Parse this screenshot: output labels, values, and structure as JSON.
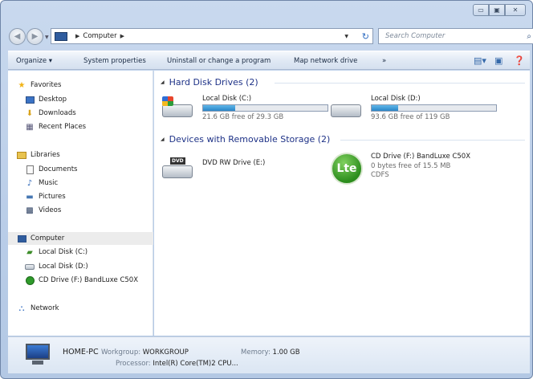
{
  "window": {
    "caption_buttons": [
      "minimize",
      "maximize",
      "close"
    ]
  },
  "address_bar": {
    "breadcrumb": "Computer",
    "search_placeholder": "Search Computer"
  },
  "command_bar": {
    "organize": "Organize",
    "system_properties": "System properties",
    "uninstall": "Uninstall or change a program",
    "map_drive": "Map network drive",
    "more": "»"
  },
  "nav_pane": {
    "favorites": "Favorites",
    "desktop": "Desktop",
    "downloads": "Downloads",
    "recent_places": "Recent Places",
    "libraries": "Libraries",
    "documents": "Documents",
    "music": "Music",
    "pictures": "Pictures",
    "videos": "Videos",
    "computer": "Computer",
    "local_c": "Local Disk (C:)",
    "local_d": "Local Disk (D:)",
    "cd_drive": "CD Drive (F:) BandLuxe C50X",
    "network": "Network"
  },
  "content": {
    "hdd_header": "Hard Disk Drives (2)",
    "drives": [
      {
        "name": "Local Disk (C:)",
        "free": "21.6 GB free of 29.3 GB",
        "used_fraction": 0.26
      },
      {
        "name": "Local Disk (D:)",
        "free": "93.6 GB free of 119 GB",
        "used_fraction": 0.21
      }
    ],
    "removable_header": "Devices with Removable Storage (2)",
    "dvd": {
      "name": "DVD RW Drive (E:)",
      "badge": "DVD"
    },
    "cd": {
      "name": "CD Drive (F:) BandLuxe C50X",
      "free": "0 bytes free of 15.5 MB",
      "fs": "CDFS",
      "logo": "Lte"
    }
  },
  "details": {
    "pc_name": "HOME-PC",
    "workgroup_label": "Workgroup:",
    "workgroup_value": "WORKGROUP",
    "memory_label": "Memory:",
    "memory_value": "1.00 GB",
    "processor_label": "Processor:",
    "processor_value": "Intel(R) Core(TM)2 CPU..."
  },
  "colors": {
    "accent": "#1e3287",
    "bar_fill": "#2a86c8"
  }
}
